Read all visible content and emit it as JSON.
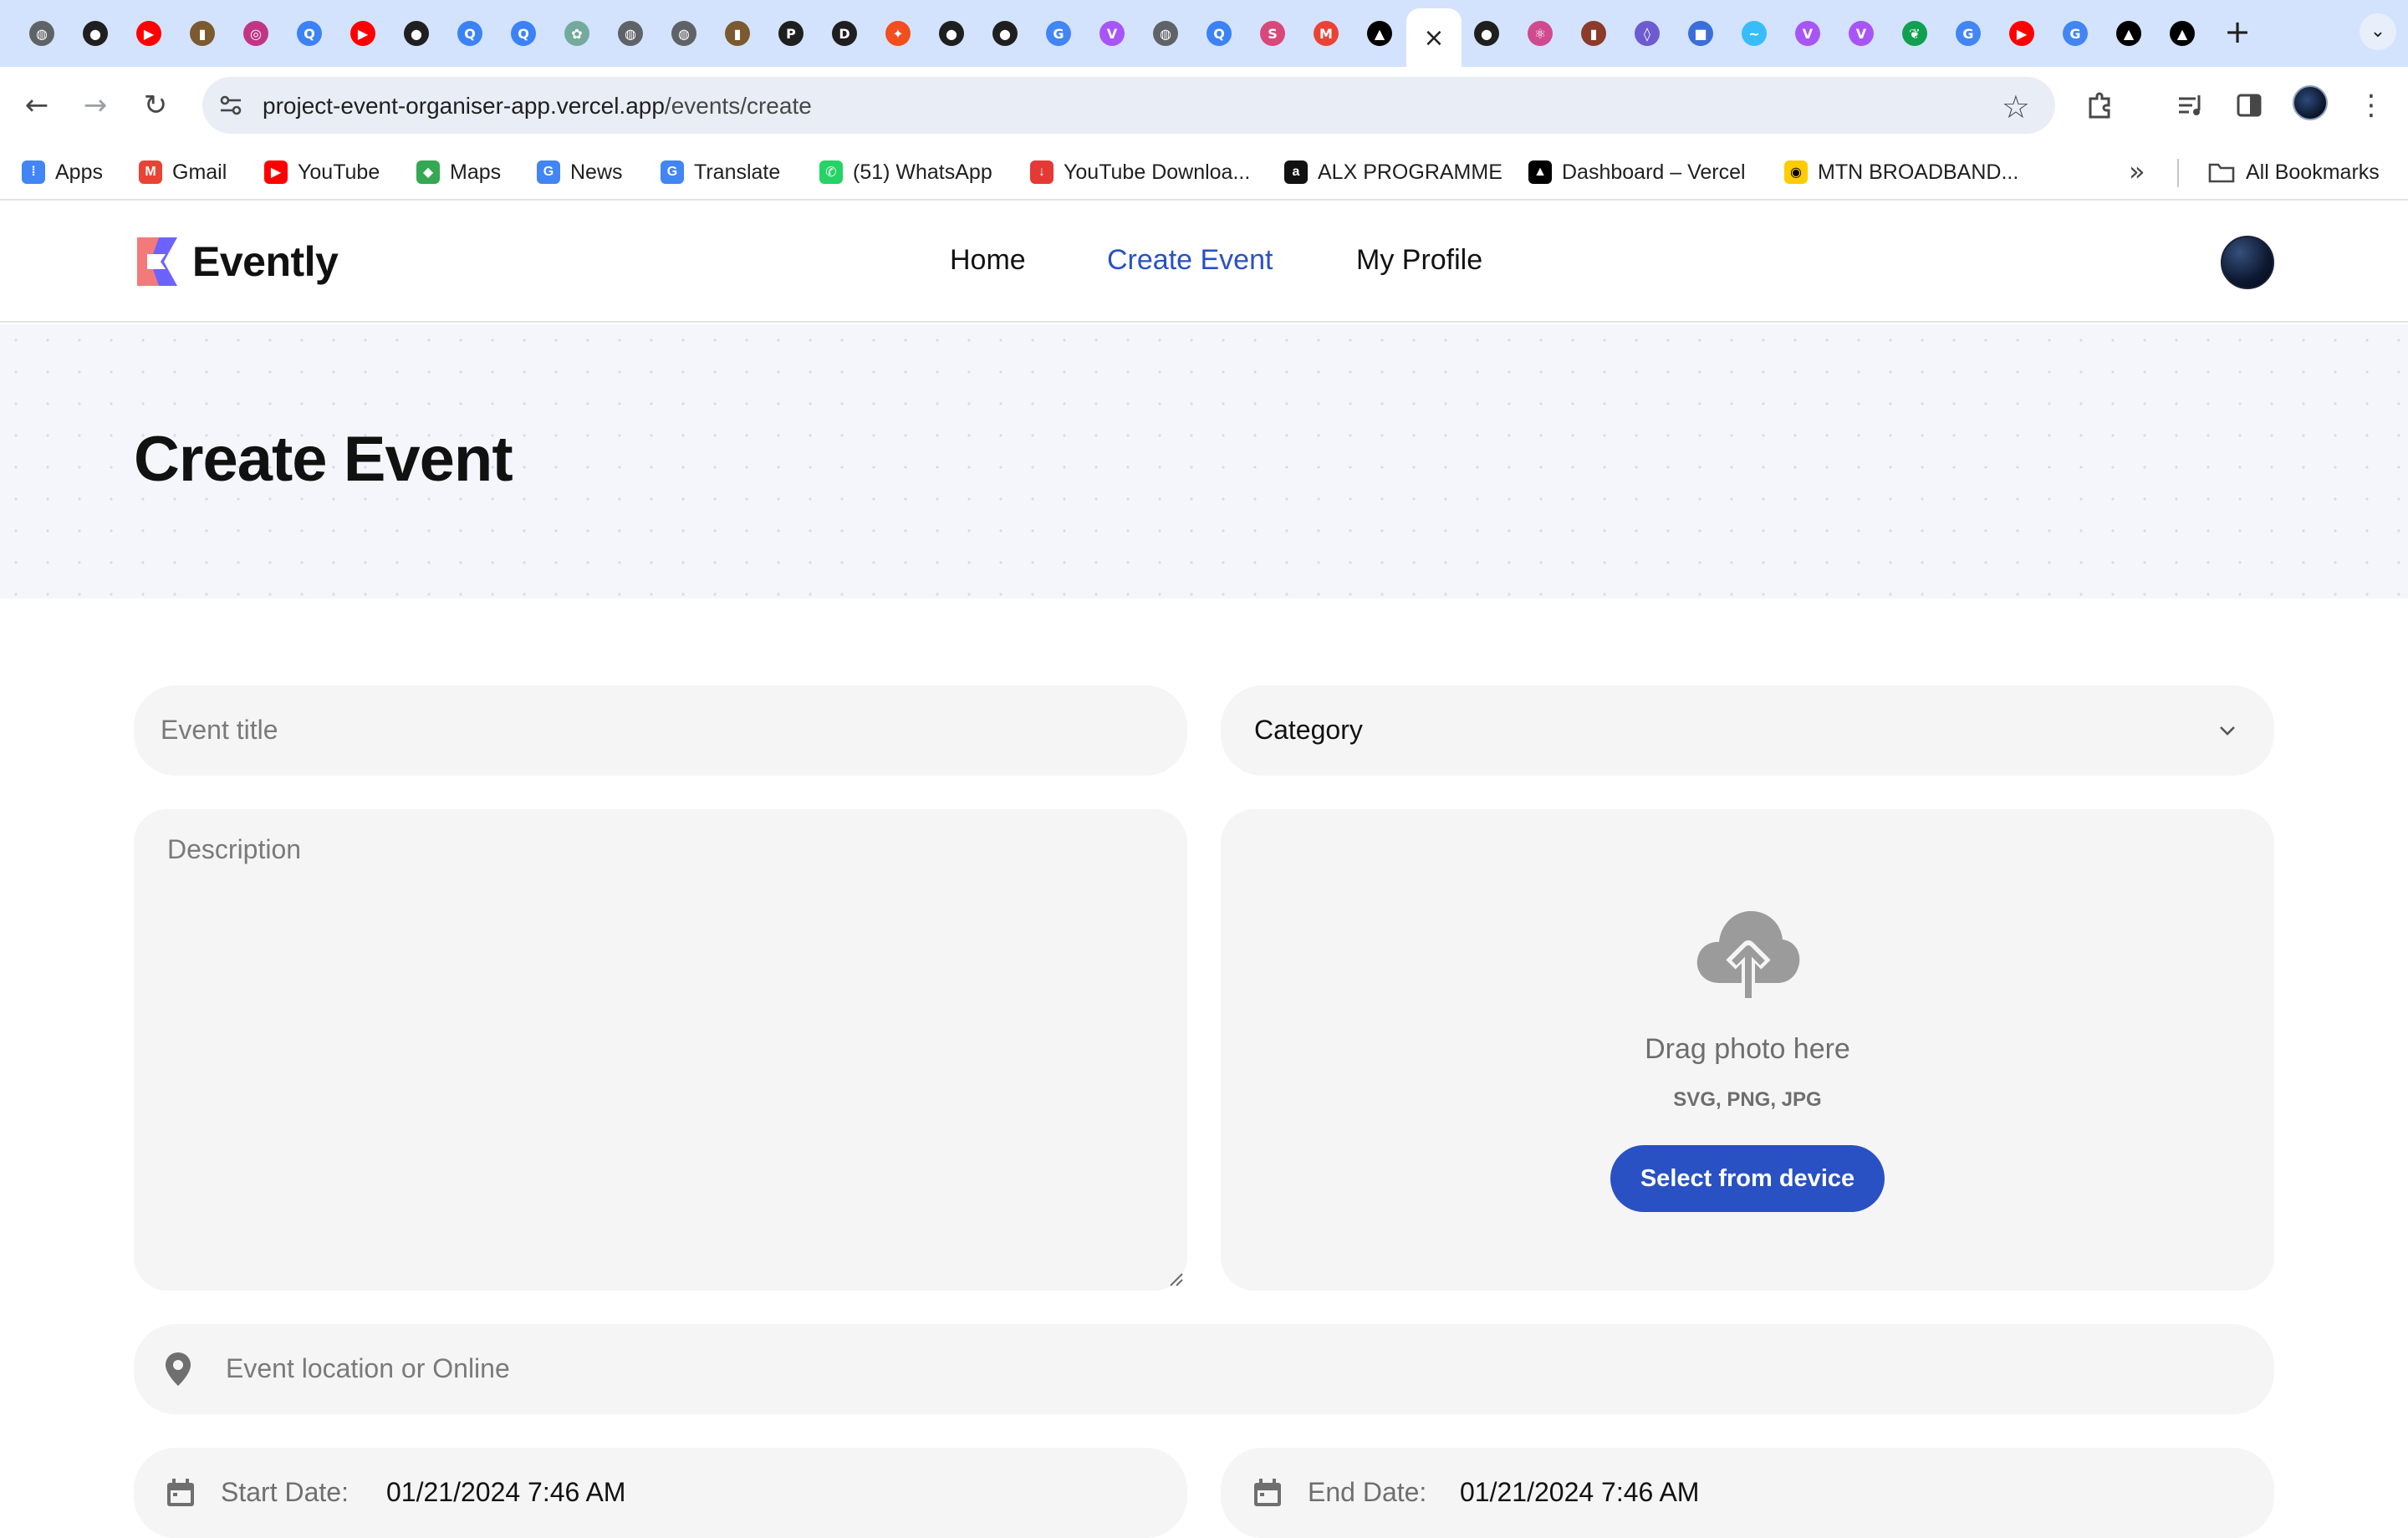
{
  "browser": {
    "tabs": [
      {
        "icon": "globe-icon"
      },
      {
        "icon": "github-icon"
      },
      {
        "icon": "youtube-icon"
      },
      {
        "icon": "image-icon"
      },
      {
        "icon": "instagram-icon"
      },
      {
        "icon": "q-icon"
      },
      {
        "icon": "youtube-icon"
      },
      {
        "icon": "github-icon"
      },
      {
        "icon": "q-icon"
      },
      {
        "icon": "q-icon"
      },
      {
        "icon": "chatgpt-icon"
      },
      {
        "icon": "globe-icon"
      },
      {
        "icon": "globe-icon"
      },
      {
        "icon": "image-icon"
      },
      {
        "icon": "p-icon"
      },
      {
        "icon": "d-icon"
      },
      {
        "icon": "figma-icon"
      },
      {
        "icon": "github-icon"
      },
      {
        "icon": "github-icon"
      },
      {
        "icon": "google-icon"
      },
      {
        "icon": "vite-icon"
      },
      {
        "icon": "globe-icon"
      },
      {
        "icon": "q-icon"
      },
      {
        "icon": "s-icon"
      },
      {
        "icon": "gmail-icon"
      },
      {
        "icon": "vercel-icon"
      },
      {
        "icon": "close-icon",
        "active": true
      },
      {
        "icon": "github-icon"
      },
      {
        "icon": "react-icon"
      },
      {
        "icon": "bottle-icon"
      },
      {
        "icon": "shield-icon"
      },
      {
        "icon": "app-icon"
      },
      {
        "icon": "tailwind-icon"
      },
      {
        "icon": "vite-icon"
      },
      {
        "icon": "vite-icon"
      },
      {
        "icon": "leaf-icon"
      },
      {
        "icon": "google-icon"
      },
      {
        "icon": "youtube-icon"
      },
      {
        "icon": "google-icon"
      },
      {
        "icon": "vercel-icon"
      },
      {
        "icon": "vercel-icon"
      }
    ],
    "active_tab_close": "×",
    "new_tab_label": "+",
    "url_host": "project-event-organiser-app.vercel.app",
    "url_path": "/events/create",
    "bookmarks": [
      {
        "label": "Apps",
        "icon": "apps-grid-icon",
        "color": "#4285f4"
      },
      {
        "label": "Gmail",
        "icon": "gmail-icon",
        "color": "#ea4335"
      },
      {
        "label": "YouTube",
        "icon": "youtube-icon",
        "color": "#ff0000"
      },
      {
        "label": "Maps",
        "icon": "maps-icon",
        "color": "#34a853"
      },
      {
        "label": "News",
        "icon": "news-icon",
        "color": "#4285f4"
      },
      {
        "label": "Translate",
        "icon": "translate-icon",
        "color": "#4285f4"
      },
      {
        "label": "(51) WhatsApp",
        "icon": "whatsapp-icon",
        "color": "#25d366"
      },
      {
        "label": "YouTube Downloa...",
        "icon": "download-icon",
        "color": "#e53935"
      },
      {
        "label": "ALX PROGRAMME",
        "icon": "alx-icon",
        "color": "#111111"
      },
      {
        "label": "Dashboard – Vercel",
        "icon": "vercel-icon",
        "color": "#000000"
      },
      {
        "label": "MTN BROADBAND...",
        "icon": "mtn-icon",
        "color": "#ffcc00"
      }
    ],
    "all_bookmarks": "All Bookmarks"
  },
  "site": {
    "brand": "Evently",
    "nav": [
      {
        "label": "Home",
        "active": false
      },
      {
        "label": "Create Event",
        "active": true
      },
      {
        "label": "My Profile",
        "active": false
      }
    ],
    "accent_color": "#2951c4"
  },
  "page": {
    "title": "Create Event"
  },
  "form": {
    "title_placeholder": "Event title",
    "category_label": "Category",
    "description_placeholder": "Description",
    "upload": {
      "title": "Drag photo here",
      "formats": "SVG, PNG, JPG",
      "button": "Select from device"
    },
    "location_placeholder": "Event location or Online",
    "start_label": "Start Date:",
    "start_value": "01/21/2024 7:46 AM",
    "end_label": "End Date:",
    "end_value": "01/21/2024 7:46 AM"
  }
}
